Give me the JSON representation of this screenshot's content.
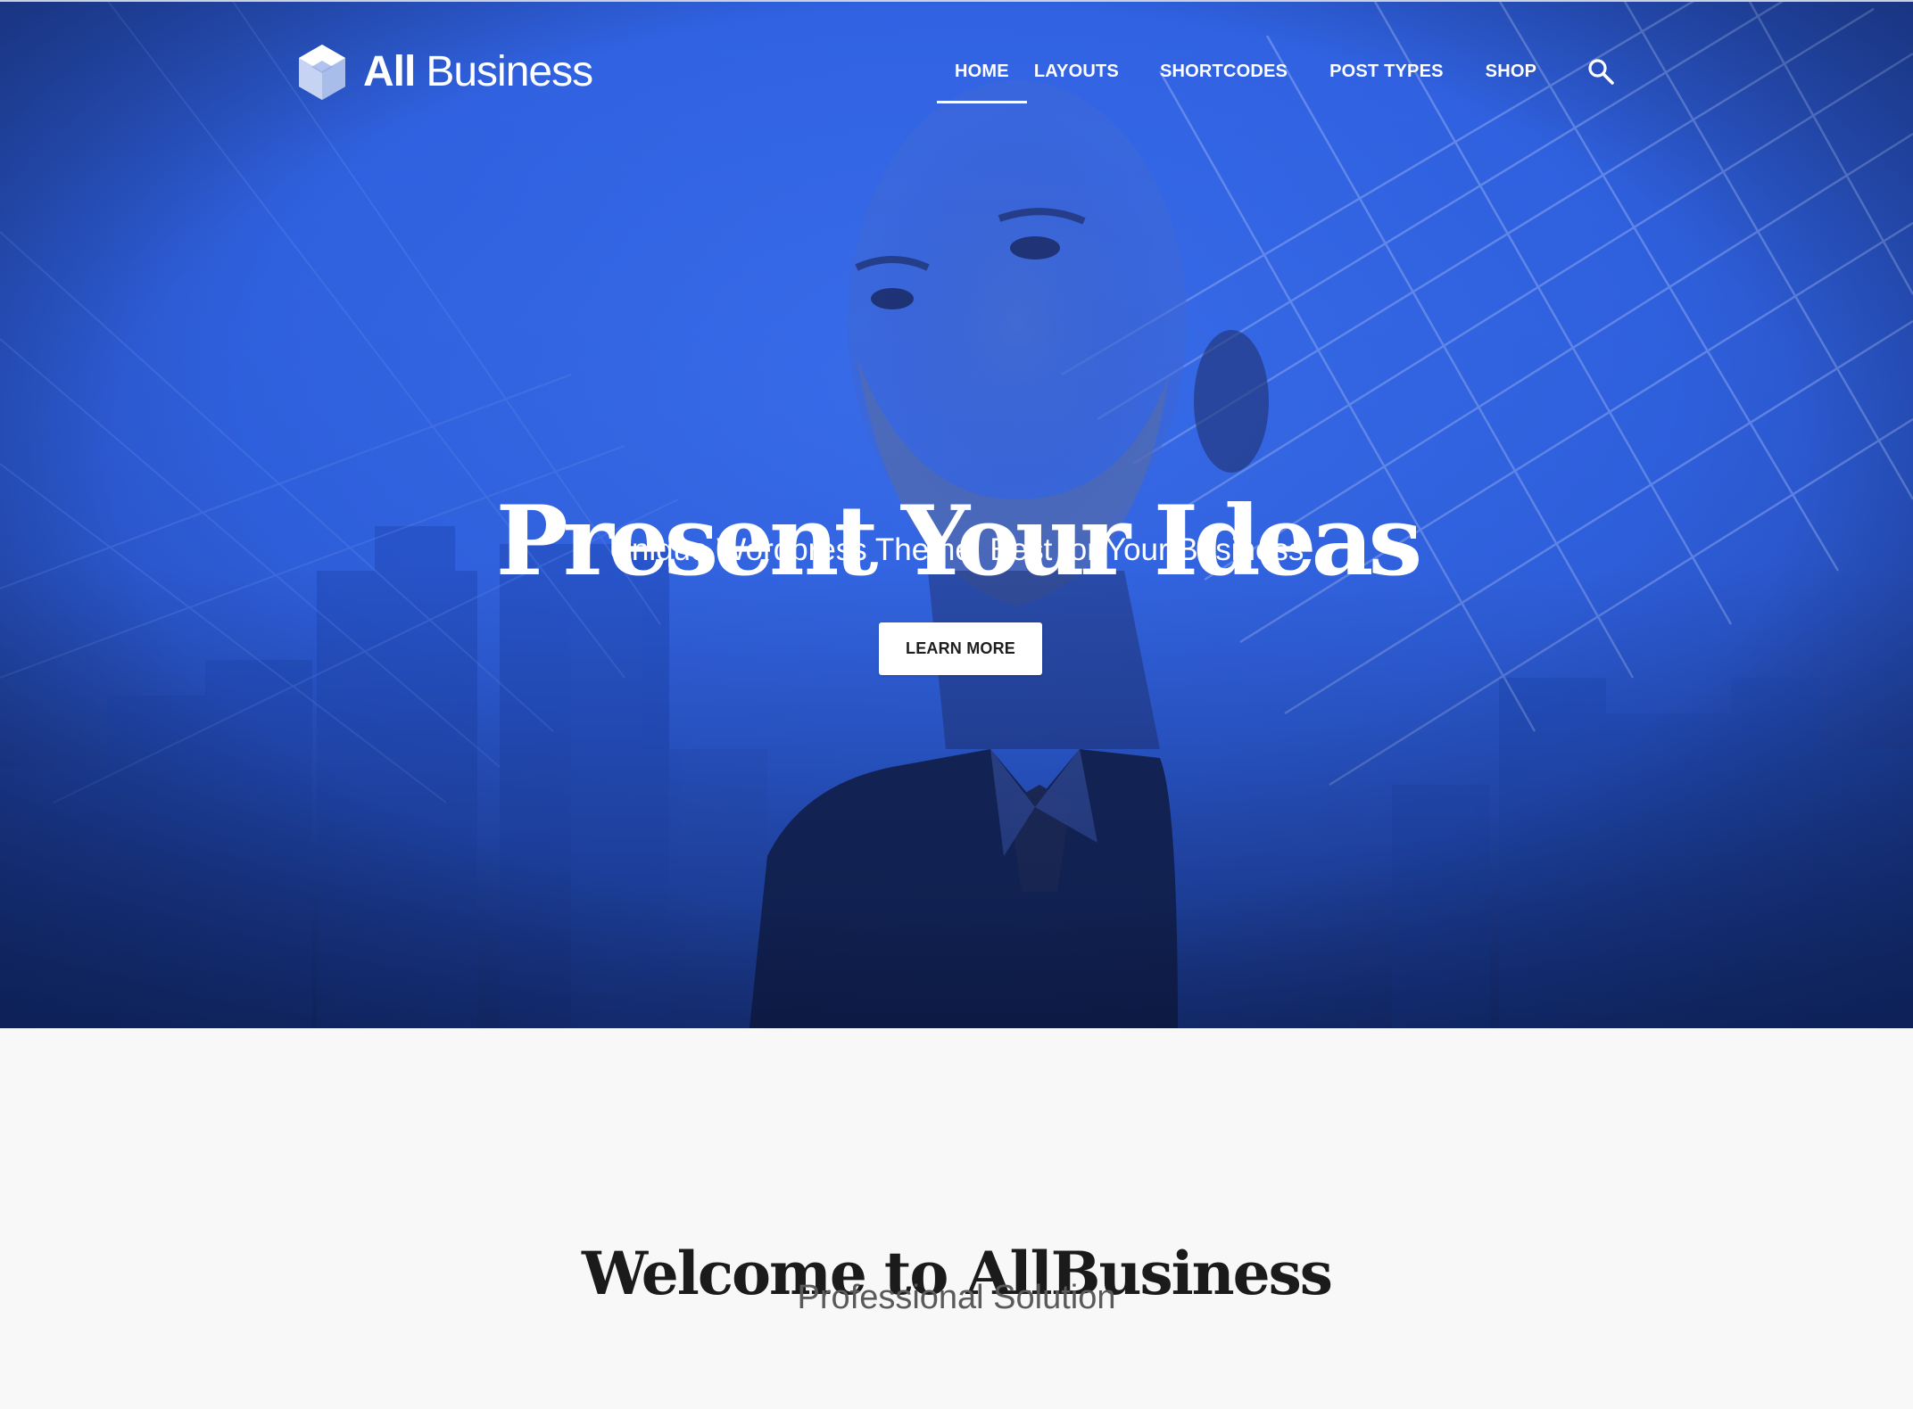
{
  "brand": {
    "name_bold": "All",
    "name_light": "Business",
    "logo_icon": "hexagon-cube-logo-icon"
  },
  "nav": {
    "items": [
      {
        "label": "HOME",
        "active": true
      },
      {
        "label": "LAYOUTS",
        "active": false
      },
      {
        "label": "SHORTCODES",
        "active": false
      },
      {
        "label": "POST TYPES",
        "active": false
      },
      {
        "label": "SHOP",
        "active": false
      }
    ],
    "search_icon": "search-icon"
  },
  "hero": {
    "title": "Present Your Ideas",
    "subtitle": "Unique Wordpress Theme. Best for Your Business",
    "button_label": "LEARN MORE"
  },
  "welcome": {
    "title": "Welcome to AllBusiness",
    "subtitle": "Professional Solution"
  },
  "colors": {
    "hero_blue": "#2f63e0",
    "hero_dark": "#172a63",
    "page_background": "#f8f8f8",
    "heading_text": "#1b1b1b",
    "subheading_text": "#5a5a5a"
  }
}
